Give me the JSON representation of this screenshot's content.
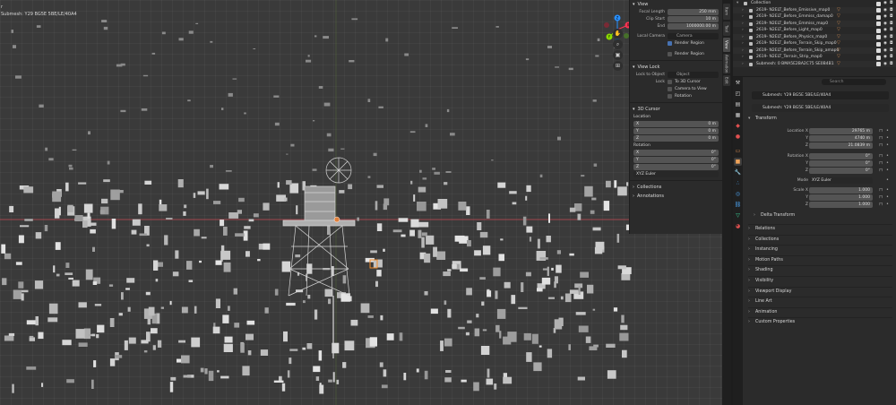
{
  "viewport": {
    "title_line1": "r",
    "title_line2": "Submesh: Y29 BG5E 5BE/LE/40A4"
  },
  "gizmo": {
    "axes": [
      "X",
      "Y",
      "Z"
    ],
    "nav_icons": [
      "hand-icon",
      "zoom-icon",
      "camera-icon",
      "grid-icon"
    ]
  },
  "npanel": {
    "view_header": "View",
    "focal_length": {
      "label": "Focal Length",
      "value": "250 mm"
    },
    "clip_start": {
      "label": "Clip Start",
      "value": "10 m"
    },
    "clip_end": {
      "label": "End",
      "value": "1000000.00 m"
    },
    "local_camera": {
      "label": "Local Camera",
      "value": "Camera"
    },
    "local_camera_check": "Render Region",
    "render_region": "Render Region",
    "view_lock_header": "View Lock",
    "lock_to_object": {
      "label": "Lock to Object",
      "value": "Object"
    },
    "lock_label": "Lock",
    "lock_options": [
      "To 3D Cursor",
      "Camera to View",
      "Rotation"
    ],
    "cursor_header": "3D Cursor",
    "location_label": "Location",
    "location": [
      {
        "axis": "X",
        "value": "0 m"
      },
      {
        "axis": "Y",
        "value": "0 m"
      },
      {
        "axis": "Z",
        "value": "0 m"
      }
    ],
    "rotation_label": "Rotation",
    "rotation": [
      {
        "axis": "X",
        "value": "0°"
      },
      {
        "axis": "Y",
        "value": "0°"
      },
      {
        "axis": "Z",
        "value": "0°"
      }
    ],
    "rotation_mode": "XYZ Euler",
    "collections": "Collections",
    "annotations": "Annotations"
  },
  "ntabs": [
    "Item",
    "Tool",
    "View",
    "Animation",
    "Edit"
  ],
  "outliner": {
    "rows": [
      {
        "name": "Collection",
        "icon": ""
      },
      {
        "name": "2619- N2ELT_Before_Emissive_map0",
        "icon": "▽"
      },
      {
        "name": "2619- N2ELT_Before_Emmiss_damap0",
        "icon": "▽"
      },
      {
        "name": "2619- N2ELT_Before_Emmiss_map0",
        "icon": "▽"
      },
      {
        "name": "2619- N2ELT_Before_Light_map0",
        "icon": "▽"
      },
      {
        "name": "2619- N2ELT_Before_Physics_map0",
        "icon": "▽"
      },
      {
        "name": "2619- N2ELT_Before_Terrain_Skip_map0",
        "icon": "▽"
      },
      {
        "name": "2619- N2ELT_Before_Terrain_Skip_amap0",
        "icon": "▽"
      },
      {
        "name": "2619- N2ELT_Terrain_Strip_map0",
        "icon": "▽"
      },
      {
        "name": "Submesh: 0 BMA5E2BA2C75 SE0B4B1",
        "icon": "▽"
      }
    ]
  },
  "properties": {
    "search_placeholder": "Search",
    "object_name": "Submesh: Y29 BG5E 5BE/LE/40A4",
    "mesh_name": "Submesh: Y29 BG5E 5BE/LE/40A4",
    "transform_header": "Transform",
    "location": [
      {
        "label": "Location X",
        "value": "29765 m"
      },
      {
        "label": "Y",
        "value": "4740 m"
      },
      {
        "label": "Z",
        "value": "21.0839 m"
      }
    ],
    "rotation": [
      {
        "label": "Rotation X",
        "value": "0°"
      },
      {
        "label": "Y",
        "value": "0°"
      },
      {
        "label": "Z",
        "value": "0°"
      }
    ],
    "mode": {
      "label": "Mode",
      "value": "XYZ Euler"
    },
    "scale": [
      {
        "label": "Scale X",
        "value": "1.000"
      },
      {
        "label": "Y",
        "value": "1.000"
      },
      {
        "label": "Z",
        "value": "1.000"
      }
    ],
    "delta_transform": "Delta Transform",
    "sections": [
      "Relations",
      "Collections",
      "Instancing",
      "Motion Paths",
      "Shading",
      "Visibility",
      "Viewport Display",
      "Line Art",
      "Animation",
      "Custom Properties"
    ]
  },
  "colors": {
    "viewport_bg": "#3a3a3a",
    "panel_bg": "#2b2b2b",
    "field_bg": "#545454",
    "accent_orange": "#d38b4f",
    "axis_red": "#ff3352",
    "axis_green": "#8bdc00",
    "axis_blue": "#2890ff"
  }
}
